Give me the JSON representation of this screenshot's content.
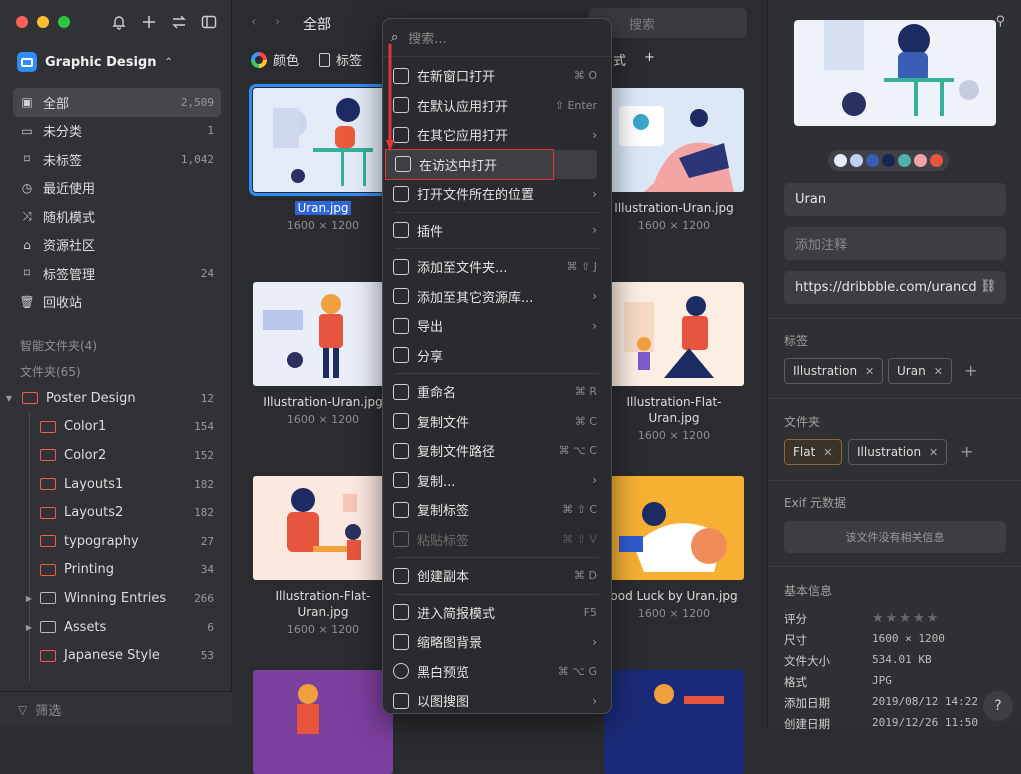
{
  "sidebar": {
    "library_name": "Graphic Design",
    "nav": [
      {
        "label": "全部",
        "count": "2,509",
        "icon": "inbox-icon"
      },
      {
        "label": "未分类",
        "count": "1",
        "icon": "folder-question-icon"
      },
      {
        "label": "未标签",
        "count": "1,042",
        "icon": "tag-off-icon"
      },
      {
        "label": "最近使用",
        "count": "",
        "icon": "clock-icon"
      },
      {
        "label": "随机模式",
        "count": "",
        "icon": "shuffle-icon"
      },
      {
        "label": "资源社区",
        "count": "",
        "icon": "community-icon"
      },
      {
        "label": "标签管理",
        "count": "24",
        "icon": "tag-icon"
      },
      {
        "label": "回收站",
        "count": "",
        "icon": "trash-icon"
      }
    ],
    "smart_folders_label": "智能文件夹(4)",
    "folders_label": "文件夹(65)",
    "folders": [
      {
        "label": "Poster Design",
        "count": "12"
      },
      {
        "label": "Color1",
        "count": "154"
      },
      {
        "label": "Color2",
        "count": "152"
      },
      {
        "label": "Layouts1",
        "count": "182"
      },
      {
        "label": "Layouts2",
        "count": "182"
      },
      {
        "label": "typography",
        "count": "27"
      },
      {
        "label": "Printing",
        "count": "34"
      },
      {
        "label": "Winning Entries",
        "count": "266"
      },
      {
        "label": "Assets",
        "count": "6"
      },
      {
        "label": "Japanese Style",
        "count": "53"
      }
    ],
    "filter_label": "筛选"
  },
  "toolbar": {
    "title": "全部",
    "search_placeholder": "搜索"
  },
  "filterbar": {
    "color": "颜色",
    "tag": "标签",
    "tail": "式"
  },
  "grid": [
    {
      "name": "Uran.jpg",
      "dim": "1600 × 1200",
      "selected": true
    },
    {
      "name": "Illustration-Uran.jpg",
      "dim": "1600 × 1200"
    },
    {
      "name": "Illustration-Uran.jpg",
      "dim": "1600 × 1200"
    },
    {
      "name": "Illustration-Flat-Uran.jpg",
      "dim": "1600 × 1200"
    },
    {
      "name": "Illustration-Flat-Uran.jpg",
      "dim": "1600 × 1200"
    },
    {
      "name": "ood Luck by Uran.jpg",
      "dim": "1600 × 1200"
    }
  ],
  "context_menu": {
    "search_placeholder": "搜索...",
    "items": [
      {
        "label": "在新窗口打开",
        "shortcut": "⌘ O"
      },
      {
        "label": "在默认应用打开",
        "shortcut": "⇧ Enter"
      },
      {
        "label": "在其它应用打开",
        "shortcut": "›"
      },
      {
        "label": "在访达中打开",
        "shortcut": ""
      },
      {
        "label": "打开文件所在的位置",
        "shortcut": "›"
      },
      {
        "label": "插件",
        "shortcut": "›"
      },
      {
        "label": "添加至文件夹...",
        "shortcut": "⌘ ⇧ J"
      },
      {
        "label": "添加至其它资源库...",
        "shortcut": "›"
      },
      {
        "label": "导出",
        "shortcut": "›"
      },
      {
        "label": "分享",
        "shortcut": ""
      },
      {
        "label": "重命名",
        "shortcut": "⌘ R"
      },
      {
        "label": "复制文件",
        "shortcut": "⌘ C"
      },
      {
        "label": "复制文件路径",
        "shortcut": "⌘ ⌥ C"
      },
      {
        "label": "复制...",
        "shortcut": "›"
      },
      {
        "label": "复制标签",
        "shortcut": "⌘ ⇧ C"
      },
      {
        "label": "粘贴标签",
        "shortcut": "⌘ ⇧ V"
      },
      {
        "label": "创建副本",
        "shortcut": "⌘ D"
      },
      {
        "label": "进入简报模式",
        "shortcut": "F5"
      },
      {
        "label": "缩略图背景",
        "shortcut": "›"
      },
      {
        "label": "黑白预览",
        "shortcut": "⌘ ⌥ G"
      },
      {
        "label": "以图搜图",
        "shortcut": "›"
      }
    ]
  },
  "inspector": {
    "name": "Uran",
    "note_placeholder": "添加注释",
    "url": "https://dribbble.com/urancd",
    "palette": [
      "#e6ecf7",
      "#c2cff0",
      "#3a5db5",
      "#1a2450",
      "#4fb3a9",
      "#f0a3a8",
      "#e8553e"
    ],
    "tags_label": "标签",
    "tags": [
      "Illustration",
      "Uran"
    ],
    "folders_label": "文件夹",
    "folders": [
      "Flat",
      "Illustration"
    ],
    "exif_label": "Exif 元数据",
    "exif_empty": "该文件没有相关信息",
    "basic_label": "基本信息",
    "info": [
      {
        "k": "评分",
        "v": ""
      },
      {
        "k": "尺寸",
        "v": "1600 × 1200"
      },
      {
        "k": "文件大小",
        "v": "534.01 KB"
      },
      {
        "k": "格式",
        "v": "JPG"
      },
      {
        "k": "添加日期",
        "v": "2019/08/12 14:22"
      },
      {
        "k": "创建日期",
        "v": "2019/12/26 11:50"
      }
    ],
    "help": "?"
  }
}
